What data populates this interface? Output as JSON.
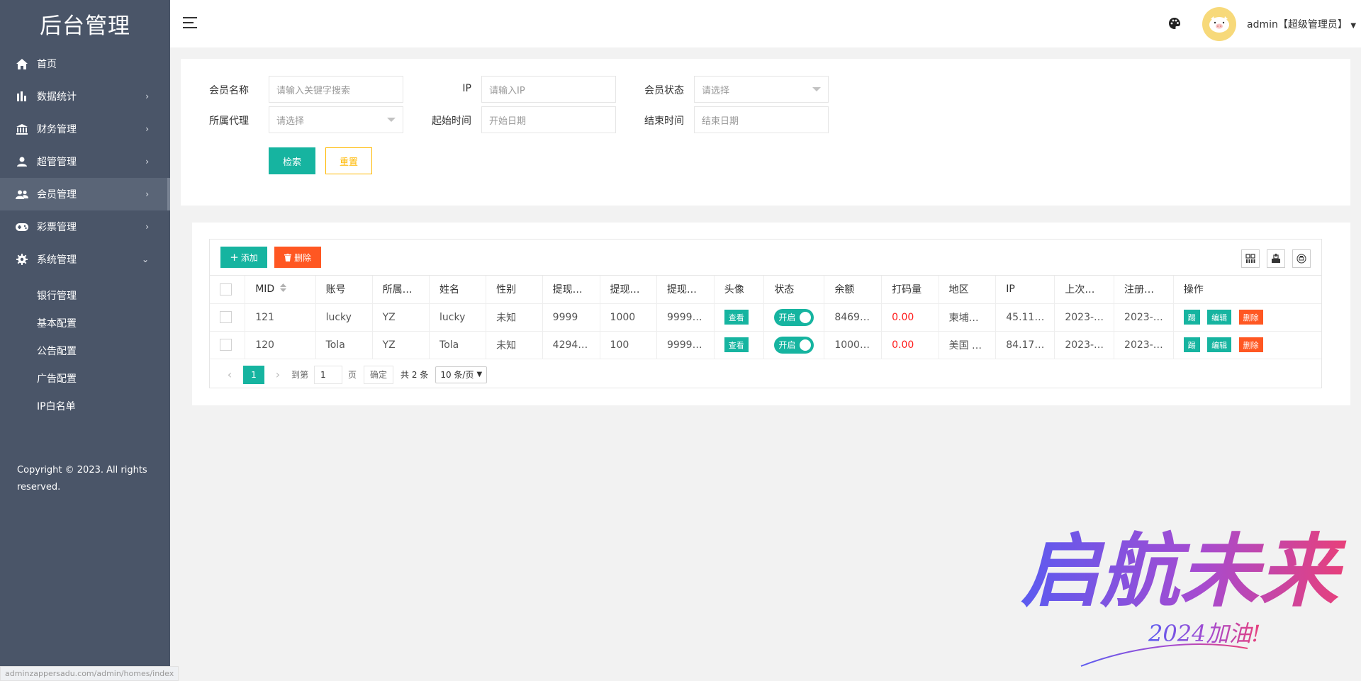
{
  "sidebar": {
    "logo": "后台管理",
    "items": [
      {
        "label": "首页",
        "icon": "home-icon"
      },
      {
        "label": "数据统计",
        "icon": "bar-chart-icon"
      },
      {
        "label": "财务管理",
        "icon": "bank-icon"
      },
      {
        "label": "超管管理",
        "icon": "user-icon"
      },
      {
        "label": "会员管理",
        "icon": "users-icon"
      },
      {
        "label": "彩票管理",
        "icon": "gamepad-icon"
      },
      {
        "label": "系统管理",
        "icon": "gear-icon"
      }
    ],
    "subitems": [
      "银行管理",
      "基本配置",
      "公告配置",
      "广告配置",
      "IP白名单"
    ],
    "copyright": "Copyright © 2023. All rights reserved."
  },
  "header": {
    "user": "admin【超级管理员】"
  },
  "search": {
    "member_name_label": "会员名称",
    "member_name_placeholder": "请输入关键字搜索",
    "ip_label": "IP",
    "ip_placeholder": "请输入IP",
    "status_label": "会员状态",
    "status_placeholder": "请选择",
    "agent_label": "所属代理",
    "agent_placeholder": "请选择",
    "start_label": "起始时间",
    "start_placeholder": "开始日期",
    "end_label": "结束时间",
    "end_placeholder": "结束日期",
    "search_btn": "检索",
    "reset_btn": "重置"
  },
  "toolbar": {
    "add_label": "添加",
    "delete_label": "删除"
  },
  "table": {
    "columns": [
      "MID",
      "账号",
      "所属…",
      "姓名",
      "性别",
      "提现…",
      "提现…",
      "提现…",
      "头像",
      "状态",
      "余额",
      "打码量",
      "地区",
      "IP",
      "上次…",
      "注册…",
      "操作"
    ],
    "rows": [
      {
        "mid": "121",
        "account": "lucky",
        "agent": "YZ",
        "name": "lucky",
        "gender": "未知",
        "w1": "9999",
        "w2": "1000",
        "w3": "9999…",
        "avatar_btn": "查看",
        "status": "开启",
        "balance": "8469…",
        "bet": "0.00",
        "region": "柬埔…",
        "ip": "45.11…",
        "last": "2023-…",
        "reg": "2023-…",
        "act1": "踢",
        "act2": "编辑",
        "act3": "删除"
      },
      {
        "mid": "120",
        "account": "Tola",
        "agent": "YZ",
        "name": "Tola",
        "gender": "未知",
        "w1": "4294…",
        "w2": "100",
        "w3": "9999…",
        "avatar_btn": "查看",
        "status": "开启",
        "balance": "1000…",
        "bet": "0.00",
        "region": "美国 …",
        "ip": "84.17…",
        "last": "2023-…",
        "reg": "2023-…",
        "act1": "踢",
        "act2": "编辑",
        "act3": "删除"
      }
    ]
  },
  "pager": {
    "current": "1",
    "goto_label": "到第",
    "goto_value": "1",
    "page_unit": "页",
    "confirm": "确定",
    "total": "共 2 条",
    "page_size": "10 条/页"
  },
  "watermark": {
    "main": "启航未来",
    "sub": "2024加油!"
  },
  "status_url": "adminzappersadu.com/admin/homes/index"
}
